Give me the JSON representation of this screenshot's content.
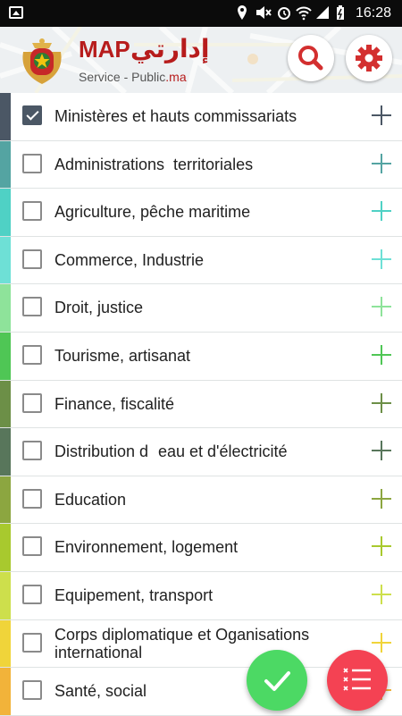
{
  "status_bar": {
    "time": "16:28"
  },
  "header": {
    "brand_title": "MAP",
    "brand_arabic": "إدارتي",
    "subtitle_main": "Service - Public",
    "subtitle_suffix": ".ma",
    "search_icon": "search-icon",
    "settings_icon": "gear-icon"
  },
  "categories": [
    {
      "label": "Ministères et hauts commissariats",
      "checked": true,
      "color": "#4b5765"
    },
    {
      "label": "Administrations  territoriales",
      "checked": false,
      "color": "#54a4a2"
    },
    {
      "label": "Agriculture, pêche maritime",
      "checked": false,
      "color": "#4fd1c5"
    },
    {
      "label": "Commerce, Industrie",
      "checked": false,
      "color": "#6ee0d6"
    },
    {
      "label": "Droit, justice",
      "checked": false,
      "color": "#8ee39a"
    },
    {
      "label": "Tourisme, artisanat",
      "checked": false,
      "color": "#4fc655"
    },
    {
      "label": "Finance, fiscalité",
      "checked": false,
      "color": "#6c8f47"
    },
    {
      "label": "Distribution deau et d'électricité",
      "checked": false,
      "color": "#58765b"
    },
    {
      "label": "Education",
      "checked": false,
      "color": "#8ca640"
    },
    {
      "label": "Environnement, logement",
      "checked": false,
      "color": "#a8c92e"
    },
    {
      "label": "Equipement, transport",
      "checked": false,
      "color": "#cddf4c"
    },
    {
      "label": "Corps diplomatique et Oganisations international",
      "checked": false,
      "color": "#f0d43a"
    },
    {
      "label": "Santé, social",
      "checked": false,
      "color": "#f2b33a"
    }
  ],
  "fabs": {
    "confirm_icon": "check-icon",
    "list_icon": "checklist-icon"
  },
  "colors": {
    "accent_red": "#b71c1c",
    "fab_green": "#4cd964",
    "fab_red": "#f44253"
  }
}
